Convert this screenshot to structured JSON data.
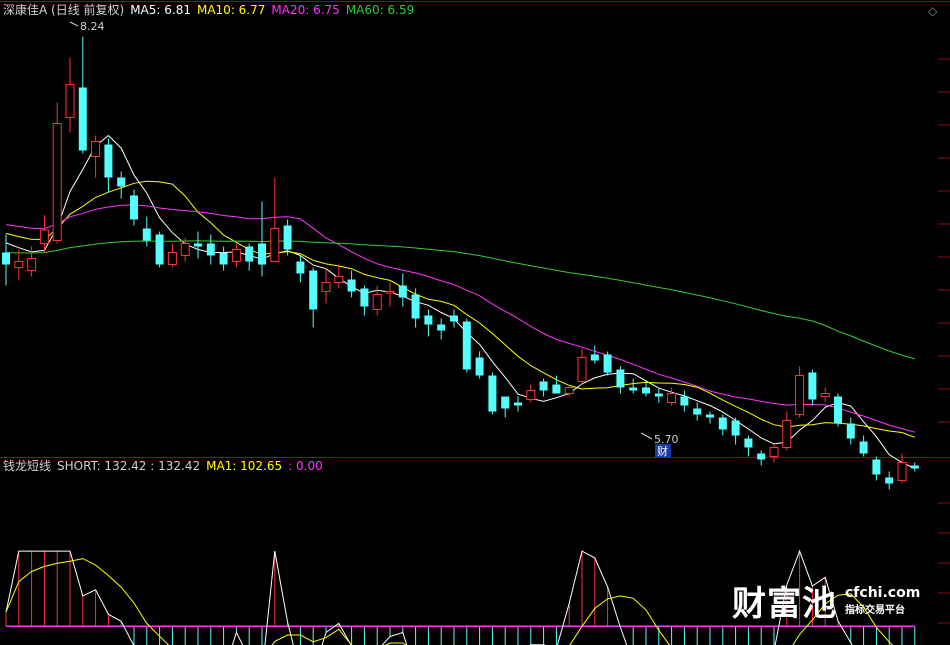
{
  "header": {
    "stock_title": "深康佳A (日线 前复权)",
    "ma5_label": "MA5: 6.81",
    "ma10_label": "MA10: 6.77",
    "ma20_label": "MA20: 6.75",
    "ma60_label": "MA60: 6.59",
    "colors": {
      "title": "#d0d0d0",
      "ma5": "#ffffff",
      "ma10": "#ffff00",
      "ma20": "#ff33ff",
      "ma60": "#33cc33"
    }
  },
  "indicator_header": {
    "name": "钱龙短线",
    "short_label": "SHORT: 132.42 : 132.42",
    "ma1_label": "MA1: 102.65",
    "zero_label": ": 0.00"
  },
  "annotations": {
    "high": "8.24",
    "low": "5.70",
    "marker": "财"
  },
  "brand": {
    "logo": "财富池",
    "domain": "cfchi.com",
    "subtitle": "指标交易平台"
  },
  "icons": {
    "settings": "diamond-icon"
  },
  "chart_data": [
    {
      "type": "candlestick",
      "title": "深康佳A (日线 前复权)",
      "ylim": [
        5.55,
        8.35
      ],
      "high_label": 8.24,
      "low_label": 5.7,
      "colors": {
        "up": "#ff3333",
        "down": "#54ffff"
      },
      "candles": [
        [
          6.8,
          6.72,
          6.92,
          6.58
        ],
        [
          6.7,
          6.74,
          6.82,
          6.62
        ],
        [
          6.68,
          6.76,
          6.84,
          6.64
        ],
        [
          6.86,
          6.95,
          7.05,
          6.8
        ],
        [
          6.88,
          7.66,
          7.8,
          6.86
        ],
        [
          7.7,
          7.92,
          8.1,
          7.6
        ],
        [
          7.9,
          7.48,
          8.24,
          7.46
        ],
        [
          7.44,
          7.54,
          7.58,
          7.3
        ],
        [
          7.52,
          7.3,
          7.56,
          7.2
        ],
        [
          7.3,
          7.24,
          7.34,
          7.16
        ],
        [
          7.18,
          7.02,
          7.22,
          6.98
        ],
        [
          6.96,
          6.88,
          7.04,
          6.84
        ],
        [
          6.92,
          6.72,
          6.94,
          6.7
        ],
        [
          6.72,
          6.8,
          6.86,
          6.7
        ],
        [
          6.78,
          6.86,
          6.9,
          6.74
        ],
        [
          6.86,
          6.84,
          6.94,
          6.76
        ],
        [
          6.86,
          6.78,
          6.92,
          6.72
        ],
        [
          6.8,
          6.72,
          6.84,
          6.68
        ],
        [
          6.74,
          6.82,
          6.86,
          6.7
        ],
        [
          6.84,
          6.74,
          6.86,
          6.68
        ],
        [
          6.86,
          6.72,
          7.14,
          6.64
        ],
        [
          6.74,
          6.96,
          7.3,
          6.84
        ],
        [
          6.98,
          6.82,
          7.02,
          6.78
        ],
        [
          6.74,
          6.66,
          6.78,
          6.6
        ],
        [
          6.68,
          6.42,
          6.7,
          6.3
        ],
        [
          6.54,
          6.6,
          6.7,
          6.46
        ],
        [
          6.6,
          6.64,
          6.72,
          6.56
        ],
        [
          6.62,
          6.54,
          6.68,
          6.5
        ],
        [
          6.56,
          6.44,
          6.58,
          6.38
        ],
        [
          6.42,
          6.52,
          6.58,
          6.38
        ],
        [
          6.54,
          6.54,
          6.6,
          6.44
        ],
        [
          6.58,
          6.5,
          6.66,
          6.44
        ],
        [
          6.52,
          6.36,
          6.56,
          6.3
        ],
        [
          6.38,
          6.32,
          6.42,
          6.24
        ],
        [
          6.32,
          6.28,
          6.36,
          6.22
        ],
        [
          6.38,
          6.34,
          6.42,
          6.3
        ],
        [
          6.34,
          6.02,
          6.36,
          6.0
        ],
        [
          6.1,
          5.98,
          6.14,
          5.96
        ],
        [
          5.98,
          5.74,
          6.0,
          5.72
        ],
        [
          5.84,
          5.76,
          5.84,
          5.7
        ],
        [
          5.8,
          5.78,
          5.84,
          5.74
        ],
        [
          5.82,
          5.88,
          5.92,
          5.8
        ],
        [
          5.94,
          5.88,
          5.96,
          5.84
        ],
        [
          5.92,
          5.86,
          5.98,
          5.86
        ],
        [
          5.86,
          5.9,
          5.92,
          5.84
        ],
        [
          5.94,
          6.1,
          6.16,
          5.92
        ],
        [
          6.12,
          6.08,
          6.18,
          6.06
        ],
        [
          6.12,
          6.0,
          6.14,
          5.98
        ],
        [
          6.02,
          5.9,
          6.04,
          5.86
        ],
        [
          5.9,
          5.88,
          5.96,
          5.86
        ],
        [
          5.9,
          5.86,
          5.94,
          5.84
        ],
        [
          5.86,
          5.84,
          5.9,
          5.8
        ],
        [
          5.8,
          5.86,
          5.9,
          5.78
        ],
        [
          5.84,
          5.78,
          5.88,
          5.74
        ],
        [
          5.76,
          5.72,
          5.8,
          5.68
        ],
        [
          5.72,
          5.7,
          5.74,
          5.66
        ],
        [
          5.7,
          5.62,
          5.72,
          5.58
        ],
        [
          5.68,
          5.58,
          5.7,
          5.52
        ],
        [
          5.56,
          5.5,
          5.58,
          5.44
        ],
        [
          5.46,
          5.42,
          5.48,
          5.38
        ],
        [
          5.44,
          5.5,
          5.52,
          5.4
        ],
        [
          5.5,
          5.68,
          5.74,
          5.48
        ],
        [
          5.72,
          5.98,
          6.04,
          5.7
        ],
        [
          6.0,
          5.82,
          6.02,
          5.78
        ],
        [
          5.84,
          5.86,
          5.9,
          5.8
        ],
        [
          5.84,
          5.66,
          5.86,
          5.64
        ],
        [
          5.66,
          5.56,
          5.7,
          5.52
        ],
        [
          5.54,
          5.46,
          5.58,
          5.44
        ],
        [
          5.42,
          5.32,
          5.44,
          5.28
        ],
        [
          5.3,
          5.26,
          5.34,
          5.22
        ],
        [
          5.28,
          5.4,
          5.46,
          5.26
        ],
        [
          5.38,
          5.36,
          5.4,
          5.34
        ]
      ]
    },
    {
      "type": "bar+line",
      "title": "钱龙短线",
      "ylim": [
        -20,
        160
      ],
      "zero_line": 0,
      "series": [
        {
          "name": "SHORT",
          "color": "#ffffff"
        },
        {
          "name": "MA1",
          "color": "#ffff00"
        }
      ]
    }
  ]
}
